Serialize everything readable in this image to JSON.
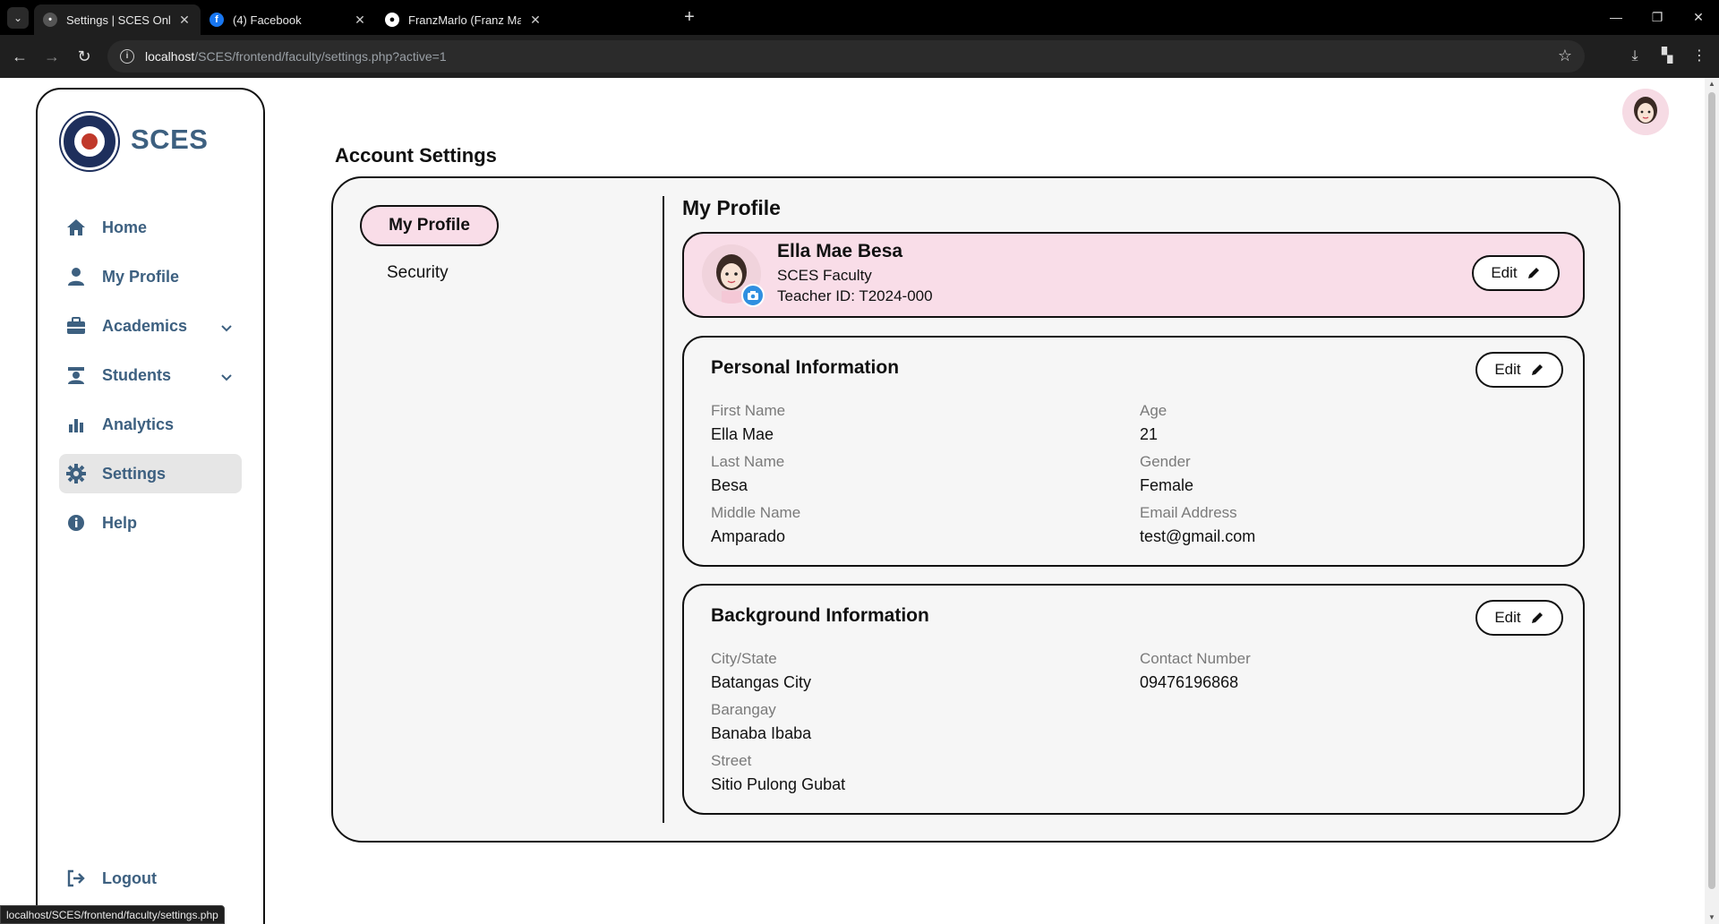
{
  "browser": {
    "tabs": [
      {
        "title": "Settings | SCES Online Learning",
        "active": true
      },
      {
        "title": "(4) Facebook",
        "active": false
      },
      {
        "title": "FranzMarlo (Franz Marlo Andal)",
        "active": false
      }
    ],
    "url_host": "localhost",
    "url_path": "/SCES/frontend/faculty/settings.php?active=1",
    "status_url": "localhost/SCES/frontend/faculty/settings.php"
  },
  "sidebar": {
    "brand": "SCES",
    "items": [
      {
        "label": "Home",
        "icon": "home-icon"
      },
      {
        "label": "My Profile",
        "icon": "user-icon"
      },
      {
        "label": "Academics",
        "icon": "briefcase-icon",
        "expandable": true
      },
      {
        "label": "Students",
        "icon": "student-icon",
        "expandable": true
      },
      {
        "label": "Analytics",
        "icon": "bar-chart-icon"
      },
      {
        "label": "Settings",
        "icon": "gear-icon",
        "active": true
      },
      {
        "label": "Help",
        "icon": "info-icon"
      }
    ],
    "logout": "Logout"
  },
  "page": {
    "title": "Account Settings",
    "tabs": {
      "my_profile": "My Profile",
      "security": "Security"
    },
    "section_heading": "My Profile"
  },
  "profile": {
    "name": "Ella Mae Besa",
    "role": "SCES Faculty",
    "teacher_id": "Teacher ID: T2024-000",
    "edit": "Edit"
  },
  "personal": {
    "heading": "Personal Information",
    "edit": "Edit",
    "first_name_label": "First Name",
    "first_name": "Ella Mae",
    "last_name_label": "Last Name",
    "last_name": "Besa",
    "middle_name_label": "Middle Name",
    "middle_name": "Amparado",
    "age_label": "Age",
    "age": "21",
    "gender_label": "Gender",
    "gender": "Female",
    "email_label": "Email Address",
    "email": "test@gmail.com"
  },
  "background": {
    "heading": "Background Information",
    "edit": "Edit",
    "city_label": "City/State",
    "city": "Batangas City",
    "barangay_label": "Barangay",
    "barangay": "Banaba Ibaba",
    "street_label": "Street",
    "street": "Sitio Pulong Gubat",
    "contact_label": "Contact Number",
    "contact": "09476196868"
  },
  "colors": {
    "accent_pink": "#f9dde8",
    "nav_blue": "#3d6080",
    "camera_blue": "#2f8fe0"
  }
}
